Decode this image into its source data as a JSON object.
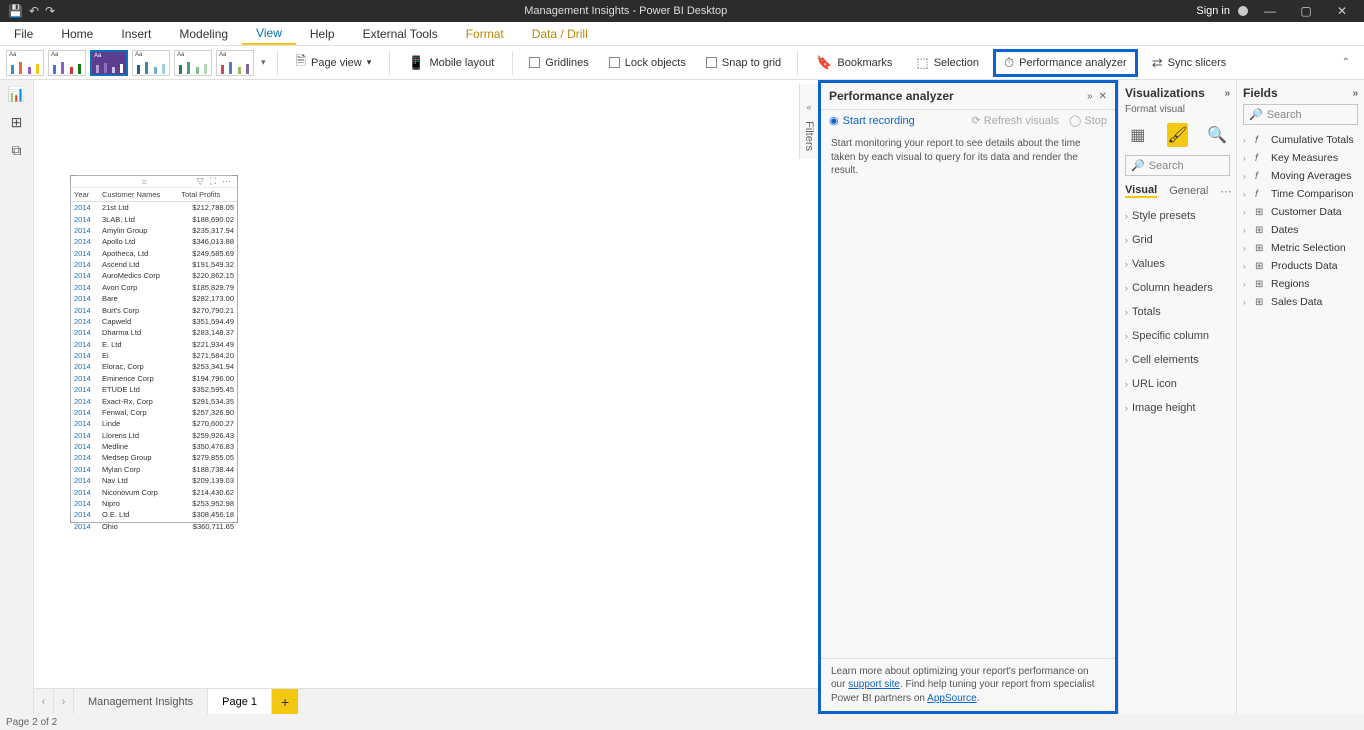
{
  "titlebar": {
    "title": "Management Insights - Power BI Desktop",
    "signin": "Sign in"
  },
  "menu": {
    "file": "File",
    "home": "Home",
    "insert": "Insert",
    "modeling": "Modeling",
    "view": "View",
    "help": "Help",
    "external": "External Tools",
    "format": "Format",
    "data": "Data / Drill"
  },
  "ribbon": {
    "pageview": "Page view",
    "mobile": "Mobile layout",
    "gridlines": "Gridlines",
    "lock": "Lock objects",
    "snap": "Snap to grid",
    "bookmarks": "Bookmarks",
    "selection": "Selection",
    "perf": "Performance analyzer",
    "sync": "Sync slicers"
  },
  "perf": {
    "title": "Performance analyzer",
    "start": "Start recording",
    "refresh": "Refresh visuals",
    "stop": "Stop",
    "msg": "Start monitoring your report to see details about the time taken by each visual to query for its data and render the result.",
    "foot1": "Learn more about optimizing your report's performance on our ",
    "foot_link1": "support site",
    "foot2": ". Find help tuning your report from specialist Power BI partners on ",
    "foot_link2": "AppSource",
    "foot3": "."
  },
  "viz": {
    "title": "Visualizations",
    "sub": "Format visual",
    "search_ph": "Search",
    "tab_visual": "Visual",
    "tab_general": "General",
    "acc": [
      "Style presets",
      "Grid",
      "Values",
      "Column headers",
      "Totals",
      "Specific column",
      "Cell elements",
      "URL icon",
      "Image height"
    ]
  },
  "fields": {
    "title": "Fields",
    "search_ph": "Search",
    "items": [
      {
        "ico": "fx",
        "label": "Cumulative Totals"
      },
      {
        "ico": "fx",
        "label": "Key Measures"
      },
      {
        "ico": "fx",
        "label": "Moving Averages"
      },
      {
        "ico": "fx",
        "label": "Time Comparison"
      },
      {
        "ico": "tbl",
        "label": "Customer Data"
      },
      {
        "ico": "tbl",
        "label": "Dates"
      },
      {
        "ico": "tbl",
        "label": "Metric Selection"
      },
      {
        "ico": "tbl",
        "label": "Products Data"
      },
      {
        "ico": "tbl",
        "label": "Regions"
      },
      {
        "ico": "tbl",
        "label": "Sales Data"
      }
    ]
  },
  "filters_label": "Filters",
  "table": {
    "headers": [
      "Year",
      "Customer Names",
      "Total Profits"
    ],
    "rows": [
      [
        "2014",
        "21st Ltd",
        "$212,788.05"
      ],
      [
        "2014",
        "3LAB, Ltd",
        "$188,690.02"
      ],
      [
        "2014",
        "Amylin Group",
        "$235,317.94"
      ],
      [
        "2014",
        "Apollo Ltd",
        "$346,013.88"
      ],
      [
        "2014",
        "Apotheca, Ltd",
        "$249,585.69"
      ],
      [
        "2014",
        "Ascend Ltd",
        "$191,549.32"
      ],
      [
        "2014",
        "AuroMedics Corp",
        "$220,862.15"
      ],
      [
        "2014",
        "Avon Corp",
        "$185,829.79"
      ],
      [
        "2014",
        "Bare",
        "$282,173.00"
      ],
      [
        "2014",
        "Burt's Corp",
        "$270,790.21"
      ],
      [
        "2014",
        "Capweld",
        "$351,594.49"
      ],
      [
        "2014",
        "Dharma Ltd",
        "$283,148.37"
      ],
      [
        "2014",
        "E. Ltd",
        "$221,934.49"
      ],
      [
        "2014",
        "Ei",
        "$271,584.20"
      ],
      [
        "2014",
        "Elorac, Corp",
        "$253,341.94"
      ],
      [
        "2014",
        "Eminence Corp",
        "$194,796.00"
      ],
      [
        "2014",
        "ETUDE Ltd",
        "$352,595.45"
      ],
      [
        "2014",
        "Exact-Rx, Corp",
        "$291,534.35"
      ],
      [
        "2014",
        "Fenwal, Corp",
        "$257,326.90"
      ],
      [
        "2014",
        "Linde",
        "$270,600.27"
      ],
      [
        "2014",
        "Llorens Ltd",
        "$259,926.43"
      ],
      [
        "2014",
        "Medline",
        "$350,476.83"
      ],
      [
        "2014",
        "Medsep Group",
        "$279,855.05"
      ],
      [
        "2014",
        "Mylan Corp",
        "$188,738.44"
      ],
      [
        "2014",
        "Nav Ltd",
        "$209,139.03"
      ],
      [
        "2014",
        "Niconovum Corp",
        "$214,430.62"
      ],
      [
        "2014",
        "Nipro",
        "$253,952.98"
      ],
      [
        "2014",
        "O.E. Ltd",
        "$308,456.18"
      ],
      [
        "2014",
        "Ohio",
        "$360,711.65"
      ]
    ]
  },
  "pages": {
    "p1": "Management Insights",
    "p2": "Page 1"
  },
  "status": "Page 2 of 2"
}
